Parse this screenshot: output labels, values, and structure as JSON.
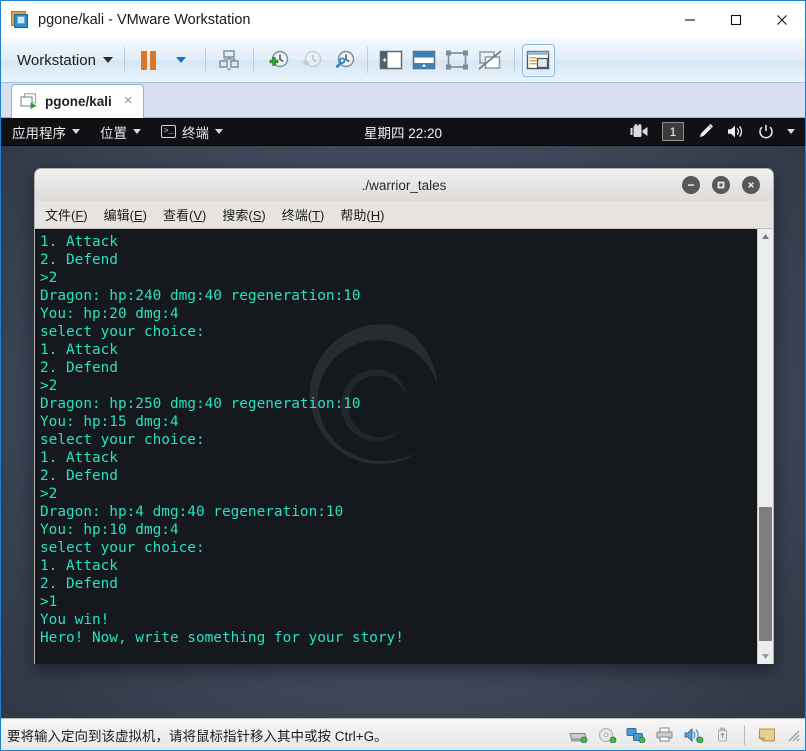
{
  "window": {
    "title": "pgone/kali - VMware Workstation",
    "app_icon": "vmware-icon",
    "controls": [
      {
        "name": "minimize-button",
        "glyph": "minimize-icon"
      },
      {
        "name": "maximize-button",
        "glyph": "maximize-icon"
      },
      {
        "name": "close-button",
        "glyph": "close-icon"
      }
    ]
  },
  "toolbar": {
    "workstation_label": "Workstation",
    "items": [
      {
        "name": "pause-button",
        "icon": "pause-icon"
      },
      {
        "name": "pause-dropdown",
        "icon": "chevron-down-icon"
      },
      {
        "name": "manage-snapshot-button",
        "icon": "snapshot-manager-icon"
      },
      {
        "name": "take-snapshot-button",
        "icon": "snapshot-add-icon"
      },
      {
        "name": "revert-snapshot-button",
        "icon": "snapshot-revert-icon"
      },
      {
        "name": "snapshot-manager-button",
        "icon": "snapshot-settings-icon"
      },
      {
        "name": "show-library-button",
        "icon": "sidebar-icon"
      },
      {
        "name": "show-thumbnails-button",
        "icon": "thumbnail-bar-icon"
      },
      {
        "name": "full-screen-button",
        "icon": "fullscreen-icon"
      },
      {
        "name": "unity-mode-button",
        "icon": "unity-mode-icon"
      },
      {
        "name": "console-view-button",
        "icon": "console-view-icon"
      }
    ]
  },
  "tabs": [
    {
      "name": "tab-pgone-kali",
      "label": "pgone/kali",
      "icon": "vm-running-icon",
      "close": "×",
      "active": true
    }
  ],
  "guest": {
    "panel": {
      "applications_label": "应用程序",
      "places_label": "位置",
      "terminal_label": "终端",
      "clock": "星期四 22:20",
      "workspace": "1",
      "tray_icons": [
        "screenshot-icon",
        "workspace-indicator",
        "pen-icon",
        "volume-icon",
        "power-icon",
        "chevron-down-icon"
      ]
    },
    "terminal": {
      "title": "./warrior_tales",
      "menus": [
        {
          "name": "menu-file",
          "text": "文件(F)",
          "pre": "文件(",
          "key": "F",
          "post": ")"
        },
        {
          "name": "menu-edit",
          "text": "编辑(E)",
          "pre": "编辑(",
          "key": "E",
          "post": ")"
        },
        {
          "name": "menu-view",
          "text": "查看(V)",
          "pre": "查看(",
          "key": "V",
          "post": ")"
        },
        {
          "name": "menu-search",
          "text": "搜索(S)",
          "pre": "搜索(",
          "key": "S",
          "post": ")"
        },
        {
          "name": "menu-terminal",
          "text": "终端(T)",
          "pre": "终端(",
          "key": "T",
          "post": ")"
        },
        {
          "name": "menu-help",
          "text": "帮助(H)",
          "pre": "帮助(",
          "key": "H",
          "post": ")"
        }
      ],
      "window_buttons": [
        "minimize-icon",
        "maximize-icon",
        "close-icon"
      ],
      "output": "1. Attack\n2. Defend\n>2\nDragon: hp:240 dmg:40 regeneration:10\nYou: hp:20 dmg:4\nselect your choice:\n1. Attack\n2. Defend\n>2\nDragon: hp:250 dmg:40 regeneration:10\nYou: hp:15 dmg:4\nselect your choice:\n1. Attack\n2. Defend\n>2\nDragon: hp:4 dmg:40 regeneration:10\nYou: hp:10 dmg:4\nselect your choice:\n1. Attack\n2. Defend\n>1\nYou win!\nHero! Now, write something for your story!",
      "text_color": "#27e2c2",
      "background_color": "#15181d"
    }
  },
  "statusbar": {
    "message": "要将输入定向到该虚拟机，请将鼠标指针移入其中或按 Ctrl+G。",
    "devices": [
      "hard-disk-icon",
      "cd-drive-icon",
      "network-adapter-icon",
      "printer-icon",
      "sound-card-icon",
      "usb-icon",
      "message-log-icon",
      "resize-grip-icon"
    ]
  },
  "colors": {
    "accent": "#1b7fd4",
    "terminal_text": "#27e2c2",
    "terminal_bg": "#15181d",
    "panel_bg": "#0f1114"
  }
}
